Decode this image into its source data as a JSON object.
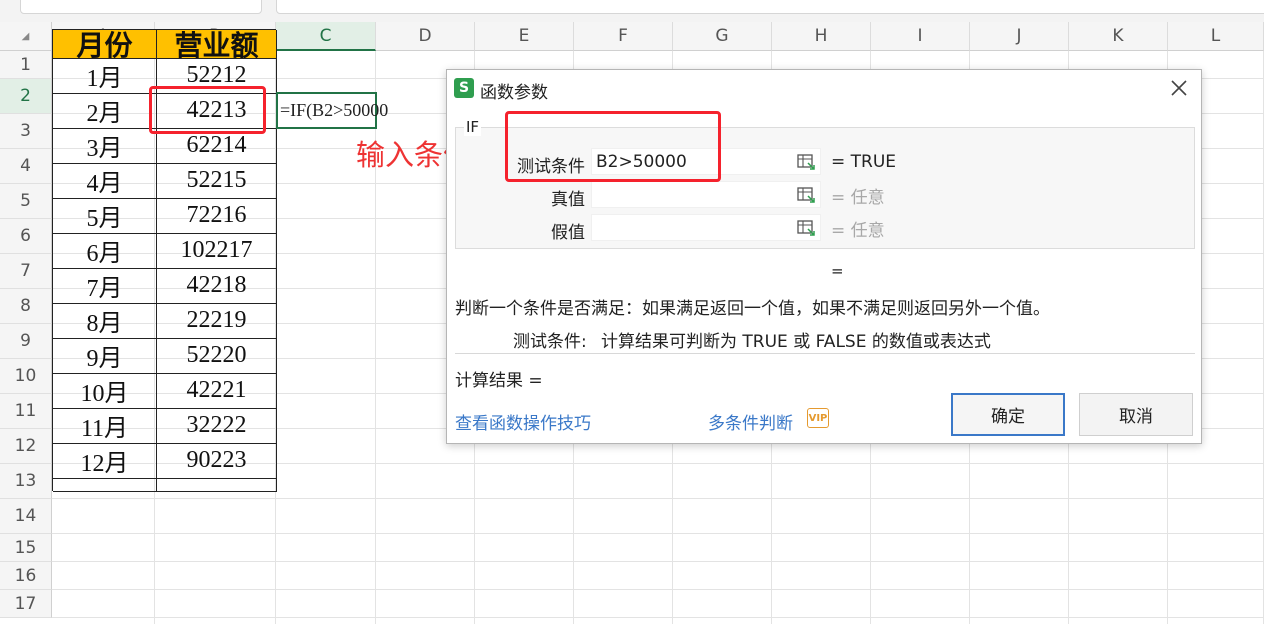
{
  "sheet": {
    "columns": [
      "A",
      "B",
      "C",
      "D",
      "E",
      "F",
      "G",
      "H",
      "I",
      "J",
      "K",
      "L"
    ],
    "rows": [
      "1",
      "2",
      "3",
      "4",
      "5",
      "6",
      "7",
      "8",
      "9",
      "10",
      "11",
      "12",
      "13",
      "14",
      "15",
      "16",
      "17"
    ],
    "active_column": "C",
    "active_row": "2",
    "header": {
      "month": "月份",
      "revenue": "营业额"
    },
    "data": [
      {
        "month": "1月",
        "revenue": "52212"
      },
      {
        "month": "2月",
        "revenue": "42213"
      },
      {
        "month": "3月",
        "revenue": "62214"
      },
      {
        "month": "4月",
        "revenue": "52215"
      },
      {
        "month": "5月",
        "revenue": "72216"
      },
      {
        "month": "6月",
        "revenue": "102217"
      },
      {
        "month": "7月",
        "revenue": "42218"
      },
      {
        "month": "8月",
        "revenue": "22219"
      },
      {
        "month": "9月",
        "revenue": "52220"
      },
      {
        "month": "10月",
        "revenue": "42221"
      },
      {
        "month": "11月",
        "revenue": "32222"
      },
      {
        "month": "12月",
        "revenue": "90223"
      }
    ],
    "formula_text": "=IF(B2>50000",
    "header_color": "#ffc000",
    "selection_color": "#217346"
  },
  "annotation": {
    "text": "输入条件",
    "color": "#ee3333"
  },
  "dialog": {
    "logo": "S",
    "title": "函数参数",
    "function_name": "IF",
    "params": [
      {
        "label": "测试条件",
        "value": "B2>50000",
        "result": "= TRUE"
      },
      {
        "label": "真值",
        "value": "",
        "result": "= 任意"
      },
      {
        "label": "假值",
        "value": "",
        "result": "= 任意"
      }
    ],
    "overall_eq": "=",
    "description": "判断一个条件是否满足：如果满足返回一个值，如果不满足则返回另外一个值。",
    "param_help_label": "测试条件:",
    "param_help_text": "计算结果可判断为 TRUE 或 FALSE 的数值或表达式",
    "calc_result": "计算结果 =",
    "link_tips": "查看函数操作技巧",
    "link_multi": "多条件判断",
    "vip_badge": "VIP",
    "ok_label": "确定",
    "cancel_label": "取消",
    "accent_color": "#3a78c8",
    "icons": {
      "logo": "wps-logo-icon",
      "close": "close-icon",
      "picker": "range-picker-icon"
    }
  }
}
